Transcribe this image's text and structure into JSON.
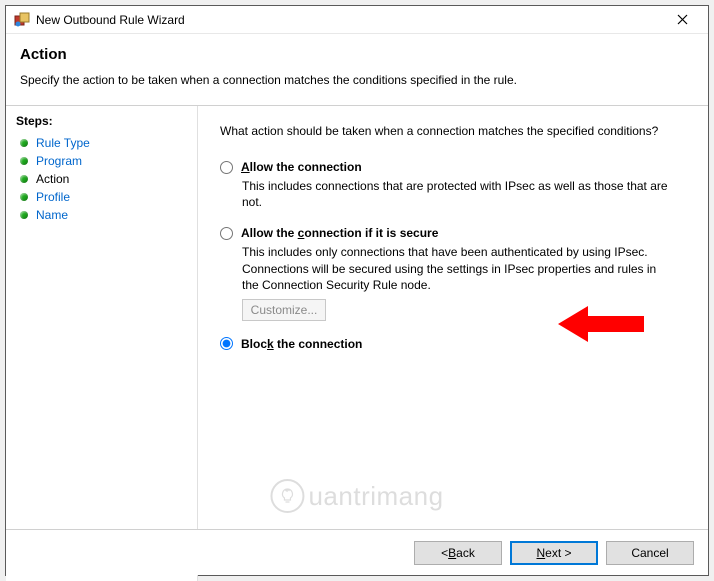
{
  "window": {
    "title": "New Outbound Rule Wizard"
  },
  "header": {
    "heading": "Action",
    "description": "Specify the action to be taken when a connection matches the conditions specified in the rule."
  },
  "steps": {
    "title": "Steps:",
    "items": [
      {
        "label": "Rule Type",
        "state": "link"
      },
      {
        "label": "Program",
        "state": "link"
      },
      {
        "label": "Action",
        "state": "current"
      },
      {
        "label": "Profile",
        "state": "link"
      },
      {
        "label": "Name",
        "state": "link"
      }
    ]
  },
  "content": {
    "prompt": "What action should be taken when a connection matches the specified conditions?",
    "options": [
      {
        "id": "allow",
        "label_pre": "",
        "label_ul": "A",
        "label_post": "llow the connection",
        "sub": "This includes connections that are protected with IPsec as well as those that are not.",
        "selected": false
      },
      {
        "id": "allow-secure",
        "label_pre": "Allow the ",
        "label_ul": "c",
        "label_post": "onnection if it is secure",
        "sub": "This includes only connections that have been authenticated by using IPsec. Connections will be secured using the settings in IPsec properties and rules in the Connection Security Rule node.",
        "selected": false,
        "customize_label": "Customize..."
      },
      {
        "id": "block",
        "label_pre": "Bloc",
        "label_ul": "k",
        "label_post": " the connection",
        "sub": "",
        "selected": true
      }
    ]
  },
  "footer": {
    "back": "< Back",
    "next": "Next >",
    "cancel": "Cancel"
  },
  "watermark": "uantrimang"
}
